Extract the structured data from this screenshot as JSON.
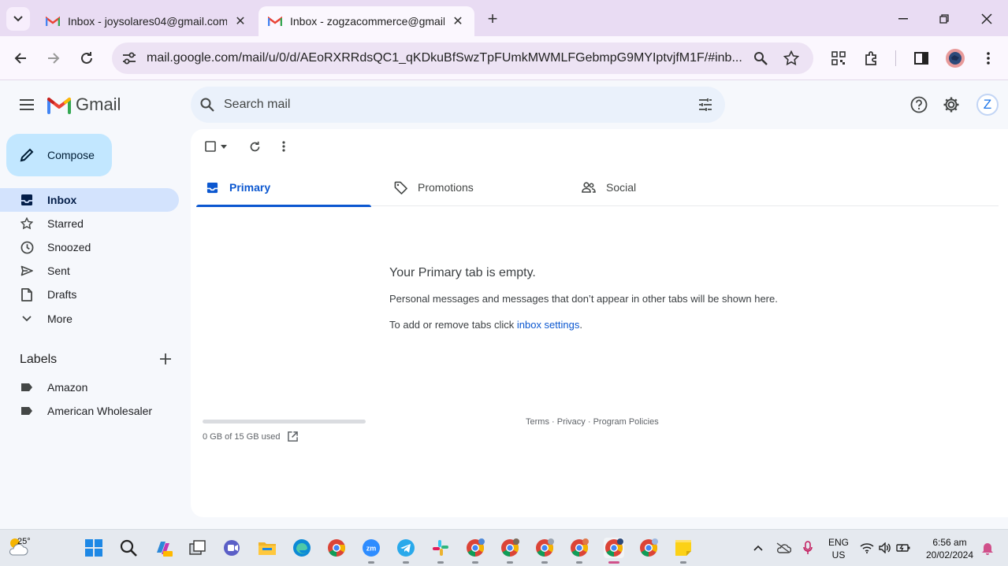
{
  "browser": {
    "tabs": [
      {
        "title": "Inbox - joysolares04@gmail.com",
        "active": false
      },
      {
        "title": "Inbox - zogzacommerce@gmail.com",
        "active": true
      }
    ],
    "url": "mail.google.com/mail/u/0/d/AEoRXRRdsQC1_qKDkuBfSwzTpFUmkMWMLFGebmpG9MYIptvjfM1F/#inb..."
  },
  "gmail": {
    "logo_text": "Gmail",
    "search": {
      "placeholder": "Search mail"
    },
    "account_initial": "Z",
    "compose_label": "Compose",
    "nav": [
      {
        "label": "Inbox",
        "icon": "inbox-icon",
        "selected": true
      },
      {
        "label": "Starred",
        "icon": "star-icon"
      },
      {
        "label": "Snoozed",
        "icon": "clock-icon"
      },
      {
        "label": "Sent",
        "icon": "send-icon"
      },
      {
        "label": "Drafts",
        "icon": "draft-icon"
      },
      {
        "label": "More",
        "icon": "chevron-down-icon"
      }
    ],
    "labels_heading": "Labels",
    "labels": [
      "Amazon",
      "American Wholesaler"
    ],
    "inbox_tabs": [
      {
        "label": "Primary",
        "icon": "inbox-icon",
        "active": true
      },
      {
        "label": "Promotions",
        "icon": "tag-icon"
      },
      {
        "label": "Social",
        "icon": "people-icon"
      }
    ],
    "empty_state": {
      "title": "Your Primary tab is empty.",
      "description": "Personal messages and messages that don’t appear in other tabs will be shown here.",
      "settings_prefix": "To add or remove tabs click ",
      "settings_link": "inbox settings",
      "settings_suffix": "."
    },
    "storage": {
      "text": "0 GB of 15 GB used",
      "used_fraction": 0.0
    },
    "footer": {
      "terms": "Terms",
      "privacy": "Privacy",
      "policies": "Program Policies",
      "sep": " · "
    }
  },
  "taskbar": {
    "weather_temp": "25°",
    "lang_line1": "ENG",
    "lang_line2": "US",
    "time": "6:56 am",
    "date": "20/02/2024"
  },
  "colors": {
    "accent": "#0b57d0",
    "compose_bg": "#c2e7ff",
    "selected_nav_bg": "#d3e3fd",
    "tabstrip_bg": "#e9dcf3"
  }
}
